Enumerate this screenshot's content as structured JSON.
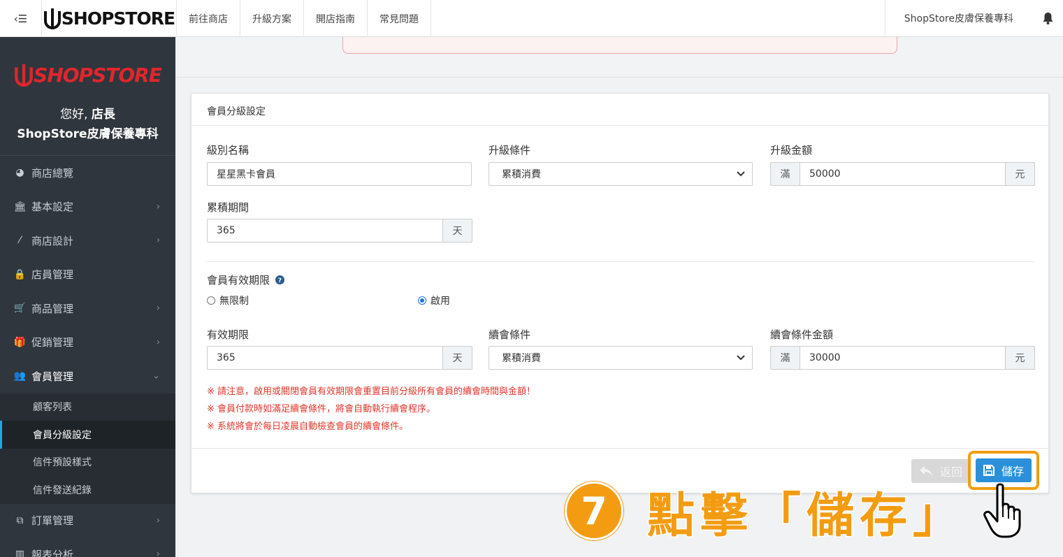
{
  "topbar": {
    "toggle_icon": "sidebar-toggle-icon",
    "logo_text": "SHOPSTORE",
    "nav": [
      "前往商店",
      "升級方案",
      "開店指南",
      "常見問題"
    ],
    "shop_name": "ShopStore皮膚保養專科",
    "bell_icon": "bell-icon"
  },
  "sidebar": {
    "logo_text": "SHOPSTORE",
    "greeting": "您好,",
    "role": "店長",
    "shop_name": "ShopStore皮膚保養專科",
    "items": [
      {
        "label": "商店總覽",
        "icon": "dashboard-icon"
      },
      {
        "label": "基本設定",
        "icon": "bank-icon"
      },
      {
        "label": "商店設計",
        "icon": "magic-wand-icon"
      },
      {
        "label": "店員管理",
        "icon": "lock-icon"
      },
      {
        "label": "商品管理",
        "icon": "cart-icon"
      },
      {
        "label": "促銷管理",
        "icon": "gift-icon"
      },
      {
        "label": "會員管理",
        "icon": "users-icon"
      },
      {
        "label": "訂單管理",
        "icon": "copy-icon"
      },
      {
        "label": "報表分析",
        "icon": "bar-chart-icon"
      }
    ],
    "member_sub": [
      "顧客列表",
      "會員分級設定",
      "信件預設樣式",
      "信件發送紀錄"
    ]
  },
  "card": {
    "title": "會員分級設定",
    "level_name_label": "級別名稱",
    "level_name_value": "星星黑卡會員",
    "upgrade_cond_label": "升級條件",
    "upgrade_cond_value": "累積消費",
    "upgrade_amount_label": "升級金額",
    "upgrade_amount_prefix": "滿",
    "upgrade_amount_value": "50000",
    "upgrade_amount_suffix": "元",
    "period_label": "累積期間",
    "period_value": "365",
    "period_suffix": "天",
    "validity_label": "會員有效期限",
    "radio_unlimited": "無限制",
    "radio_enabled": "啟用",
    "valid_label": "有效期限",
    "valid_value": "365",
    "valid_suffix": "天",
    "renew_cond_label": "續會條件",
    "renew_cond_value": "累積消費",
    "renew_amount_label": "續會條件金額",
    "renew_amount_prefix": "滿",
    "renew_amount_value": "30000",
    "renew_amount_suffix": "元",
    "notes": [
      "※ 請注意，啟用或關閉會員有效期限會重置目前分級所有會員的續會時間與金額！",
      "※ 會員付款時如滿足續會條件，將會自動執行續會程序。",
      "※ 系統將會於每日凌晨自動檢查會員的續會條件。"
    ],
    "back_label": "返回",
    "save_label": "儲存"
  },
  "annotation": {
    "step": "7",
    "text": "點擊「儲存」"
  },
  "colors": {
    "accent": "#2b90d9",
    "highlight": "#f39c12",
    "sidebar_bg": "#2f363d",
    "note_red": "#e0372c"
  }
}
